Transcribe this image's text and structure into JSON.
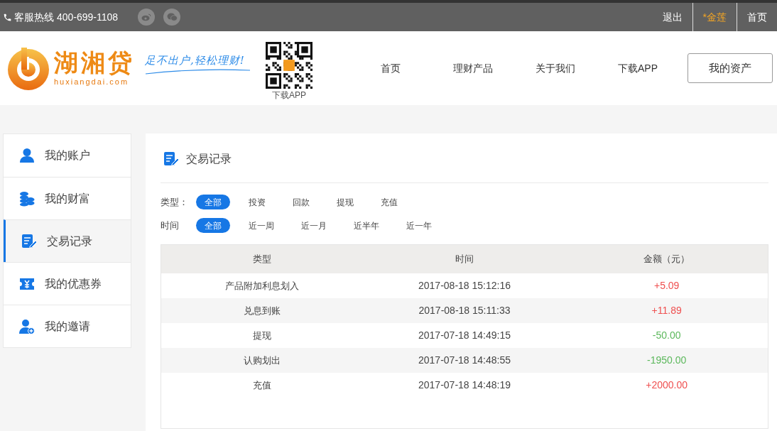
{
  "top_bar": {
    "hotline": "客服热线 400-699-1108",
    "links": [
      {
        "label": "退出",
        "highlighted": false
      },
      {
        "label": "*金莲",
        "highlighted": true
      },
      {
        "label": "首页",
        "highlighted": false
      }
    ]
  },
  "header": {
    "logo_name": "湖湘贷",
    "logo_domain": "huxiangdai.com",
    "slogan": "足不出户,轻松理财!",
    "qr_caption": "下载APP",
    "nav": [
      "首页",
      "理财产品",
      "关于我们",
      "下载APP"
    ],
    "assets_button": "我的资产"
  },
  "sidebar": {
    "items": [
      {
        "label": "我的账户",
        "selected": false
      },
      {
        "label": "我的财富",
        "selected": false
      },
      {
        "label": "交易记录",
        "selected": true
      },
      {
        "label": "我的优惠券",
        "selected": false
      },
      {
        "label": "我的邀请",
        "selected": false
      }
    ]
  },
  "panel": {
    "title": "交易记录",
    "filters": [
      {
        "label": "类型：",
        "options": [
          {
            "label": "全部",
            "selected": true
          },
          {
            "label": "投资",
            "selected": false
          },
          {
            "label": "回款",
            "selected": false
          },
          {
            "label": "提现",
            "selected": false
          },
          {
            "label": "充值",
            "selected": false
          }
        ]
      },
      {
        "label": "时间",
        "options": [
          {
            "label": "全部",
            "selected": true
          },
          {
            "label": "近一周",
            "selected": false
          },
          {
            "label": "近一月",
            "selected": false
          },
          {
            "label": "近半年",
            "selected": false
          },
          {
            "label": "近一年",
            "selected": false
          }
        ]
      }
    ],
    "table": {
      "columns": [
        "类型",
        "时间",
        "金额（元）"
      ],
      "rows": [
        {
          "type": "产品附加利息划入",
          "time": "2017-08-18 15:12:16",
          "amount": "+5.09",
          "color": "#ef4f4f"
        },
        {
          "type": "兑息到账",
          "time": "2017-08-18 15:11:33",
          "amount": "+11.89",
          "color": "#ef4f4f"
        },
        {
          "type": "提现",
          "time": "2017-07-18 14:49:15",
          "amount": "-50.00",
          "color": "#5cb85c"
        },
        {
          "type": "认购划出",
          "time": "2017-07-18 14:48:55",
          "amount": "-1950.00",
          "color": "#5cb85c"
        },
        {
          "type": "充值",
          "time": "2017-07-18 14:48:19",
          "amount": "+2000.00",
          "color": "#ef4f4f"
        }
      ]
    }
  }
}
